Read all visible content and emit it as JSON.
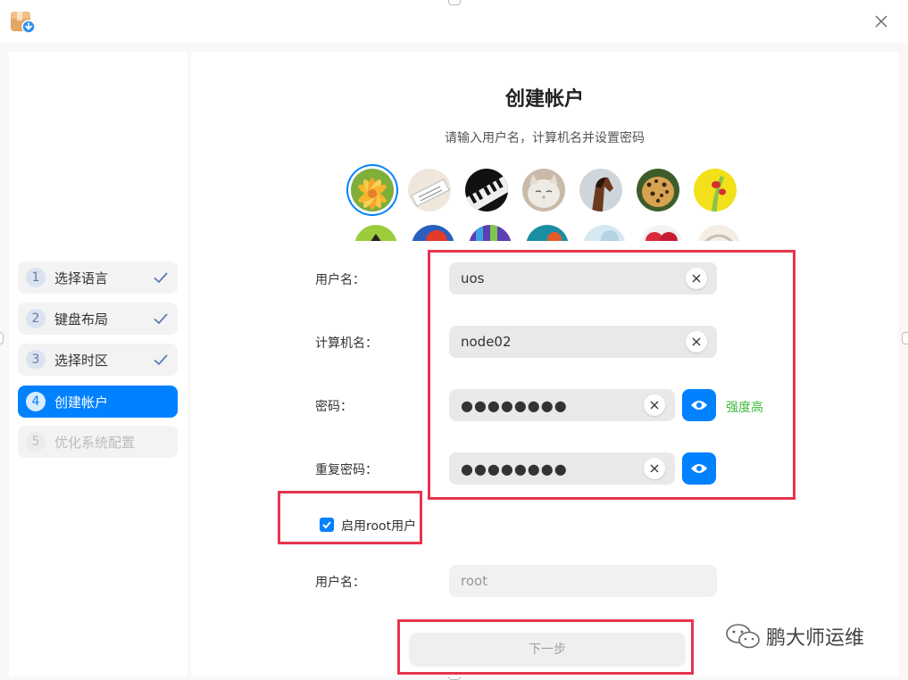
{
  "window": {
    "close_icon": "close-icon",
    "app_icon": "installer-icon"
  },
  "sidebar": {
    "steps": [
      {
        "num": "1",
        "label": "选择语言",
        "state": "done"
      },
      {
        "num": "2",
        "label": "键盘布局",
        "state": "done"
      },
      {
        "num": "3",
        "label": "选择时区",
        "state": "done"
      },
      {
        "num": "4",
        "label": "创建帐户",
        "state": "active"
      },
      {
        "num": "5",
        "label": "优化系统配置",
        "state": "disabled"
      }
    ]
  },
  "main": {
    "title": "创建帐户",
    "subtitle": "请输入用户名，计算机名并设置密码",
    "username_label": "用户名：",
    "username_value": "uos",
    "hostname_label": "计算机名：",
    "hostname_value": "node02",
    "password_label": "密码：",
    "password_value": "●●●●●●●●",
    "password_strength": "强度高",
    "repeat_label": "重复密码：",
    "repeat_value": "●●●●●●●●",
    "root_checkbox_label": "启用root用户",
    "root_checked": true,
    "root_username_label": "用户名：",
    "root_username_value": "root",
    "next_label": "下一步"
  },
  "watermark": {
    "text": "鹏大师运维"
  },
  "colors": {
    "accent": "#0081ff",
    "highlight": "#e8344f",
    "strength": "#3cba3c"
  }
}
